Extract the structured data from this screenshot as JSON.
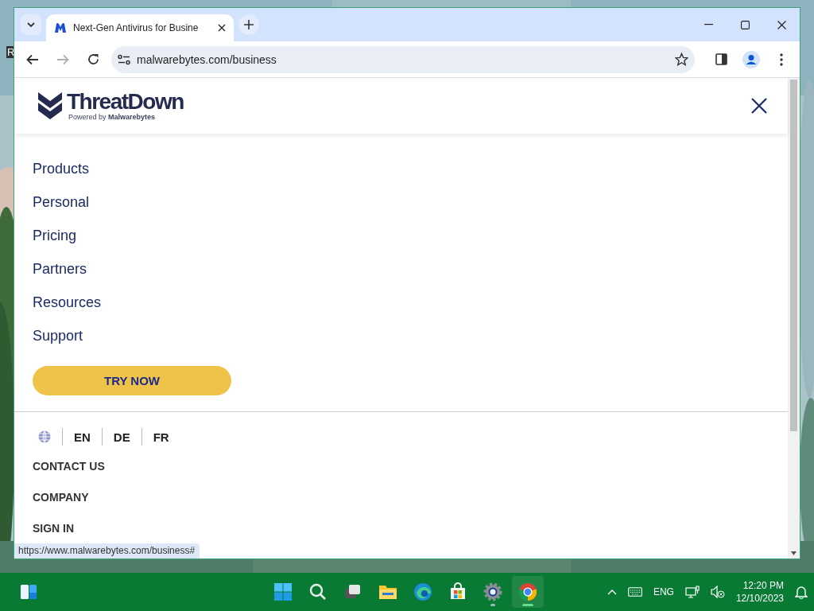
{
  "desktop": {
    "icon_label": "R"
  },
  "browser": {
    "tabs": [
      {
        "title": "Next-Gen Antivirus for Busine",
        "selected": true
      }
    ],
    "address": "malwarebytes.com/business",
    "nav": {
      "forward_disabled": true
    }
  },
  "page": {
    "logo": {
      "name": "ThreatDown",
      "tagline": "Powered by",
      "brand": "Malwarebytes"
    },
    "menu": [
      {
        "label": "Products"
      },
      {
        "label": "Personal"
      },
      {
        "label": "Pricing"
      },
      {
        "label": "Partners"
      },
      {
        "label": "Resources"
      },
      {
        "label": "Support"
      }
    ],
    "cta": "TRY NOW",
    "languages": [
      {
        "code": "EN"
      },
      {
        "code": "DE"
      },
      {
        "code": "FR"
      }
    ],
    "links": [
      {
        "label": "CONTACT US"
      },
      {
        "label": "COMPANY"
      },
      {
        "label": "SIGN IN"
      }
    ]
  },
  "status_url": "https://www.malwarebytes.com/business#",
  "taskbar": {
    "apps": [
      {
        "kind": "search",
        "selected": false
      },
      {
        "kind": "taskview",
        "selected": false
      },
      {
        "kind": "folder",
        "selected": false
      },
      {
        "kind": "edge",
        "selected": false
      },
      {
        "kind": "store",
        "selected": false
      },
      {
        "kind": "settings",
        "selected": false
      },
      {
        "kind": "chrome",
        "selected": true
      }
    ],
    "language": "ENG",
    "time": "12:20 PM",
    "date": "12/10/2023"
  }
}
